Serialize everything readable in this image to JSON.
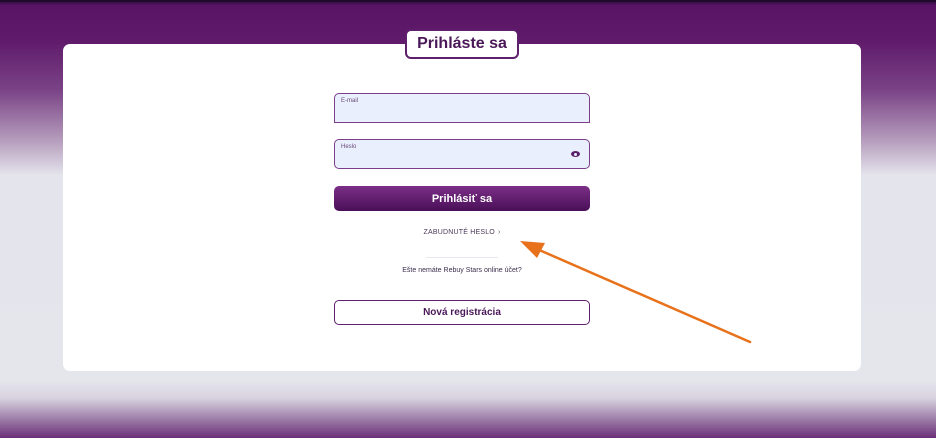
{
  "login": {
    "title": "Prihláste sa",
    "email": {
      "label": "E-mail",
      "value": ""
    },
    "password": {
      "label": "Heslo",
      "value": ""
    },
    "login_label": "Prihlásiť sa",
    "forgot_label": "ZABUDNUTÉ HESLO",
    "forgot_chevron": "›",
    "no_account_text": "Ešte nemáte Rebuy Stars online účet?",
    "register_label": "Nová registrácia"
  },
  "colors": {
    "brand": "#5e1f6d",
    "button": "#4a0f58",
    "arrow": "#e8721c",
    "field_bg": "#e9effd"
  },
  "icons": {
    "password_toggle": "eye-icon"
  }
}
